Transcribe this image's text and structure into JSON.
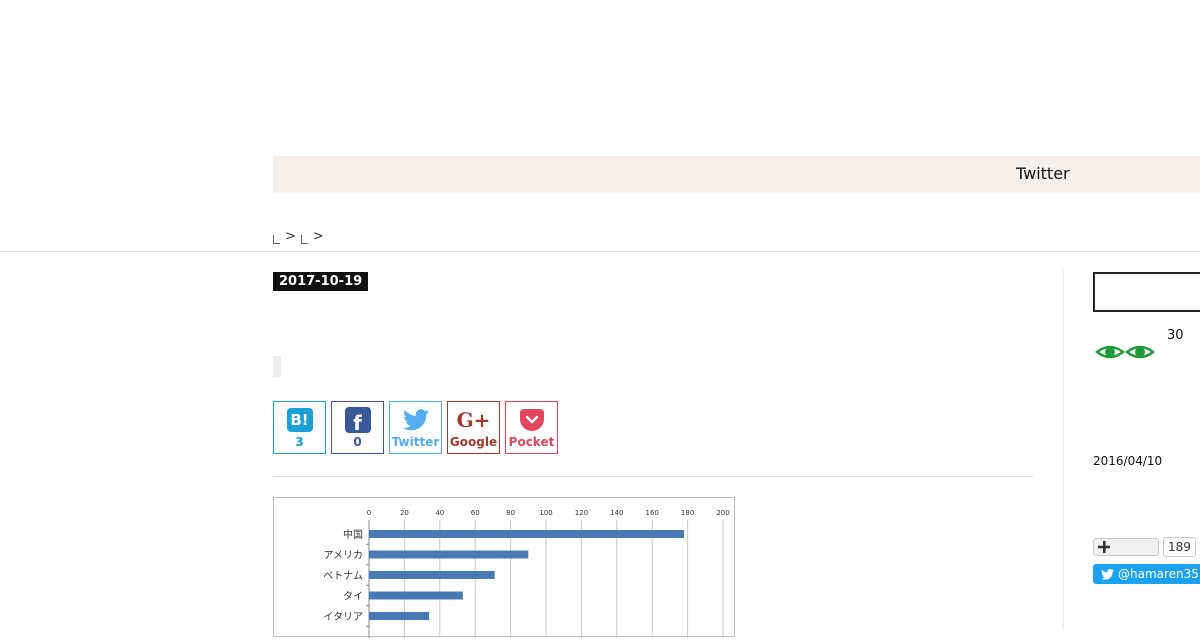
{
  "nav": {
    "twitter_label": "Twitter"
  },
  "breadcrumb": {
    "sep1": ">",
    "sep2": ">"
  },
  "article": {
    "date": "2017-10-19",
    "share": {
      "hatena": {
        "icon_text": "B!",
        "count": "3"
      },
      "facebook": {
        "icon_text": "f",
        "count": "0"
      },
      "twitter": {
        "label": "Twitter"
      },
      "google": {
        "icon_text": "G+",
        "label": "Google"
      },
      "pocket": {
        "label": "Pocket"
      }
    }
  },
  "chart_data": {
    "type": "bar",
    "orientation": "horizontal",
    "categories": [
      "中国",
      "アメリカ",
      "ベトナム",
      "タイ",
      "イタリア"
    ],
    "values": [
      178,
      90,
      71,
      53,
      34
    ],
    "xticks": [
      0,
      20,
      40,
      60,
      80,
      100,
      120,
      140,
      160,
      180,
      200
    ],
    "xlim": [
      0,
      200
    ],
    "grid": true,
    "color": "#4a7ab5"
  },
  "sidebar": {
    "eyes_count": "30",
    "date": "2016/04/10",
    "follow_count": "189",
    "twitter_handle": "@hamaren35"
  },
  "colors": {
    "eye_green": "#1f9a3a",
    "twitter_blue": "#1da1f2"
  }
}
